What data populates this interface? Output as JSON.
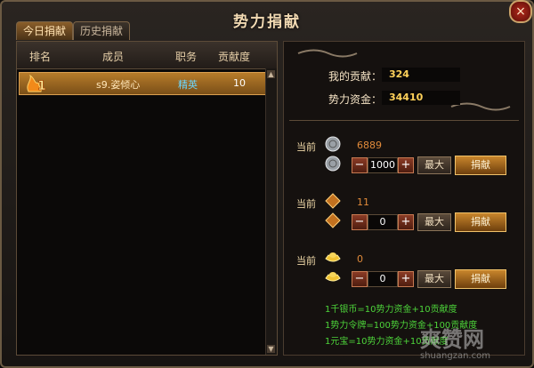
{
  "window": {
    "title": "势力捐献",
    "close_label": "×"
  },
  "tabs": [
    {
      "label": "今日捐献",
      "active": true
    },
    {
      "label": "历史捐献",
      "active": false
    }
  ],
  "table": {
    "headers": [
      "排名",
      "成员",
      "职务",
      "贡献度"
    ],
    "rows": [
      {
        "rank": "1",
        "member": "s9.姿倾心",
        "position": "精英",
        "contribution": "10"
      }
    ]
  },
  "info": {
    "my_contribution_label": "我的贡献：",
    "my_contribution_value": "324",
    "funds_label": "势力资金：",
    "funds_value": "34410"
  },
  "donations": [
    {
      "current_label": "当前",
      "icon": "silver-coin-icon",
      "current_value": "6889",
      "input_value": "1000",
      "max_label": "最大",
      "donate_label": "捐献"
    },
    {
      "current_label": "当前",
      "icon": "faction-token-icon",
      "current_value": "11",
      "input_value": "0",
      "max_label": "最大",
      "donate_label": "捐献"
    },
    {
      "current_label": "当前",
      "icon": "gold-ingot-icon",
      "current_value": "0",
      "input_value": "0",
      "max_label": "最大",
      "donate_label": "捐献"
    }
  ],
  "notes": [
    "1千银币=10势力资金+10贡献度",
    "1势力令牌=100势力资金+100贡献度",
    "1元宝=10势力资金+10贡献度"
  ],
  "watermark": {
    "text": "爽赞网",
    "url": "shuangzan.com"
  },
  "colors": {
    "accent": "#d8a449",
    "green_note": "#4dd43a",
    "value_gold": "#ffd25a"
  }
}
